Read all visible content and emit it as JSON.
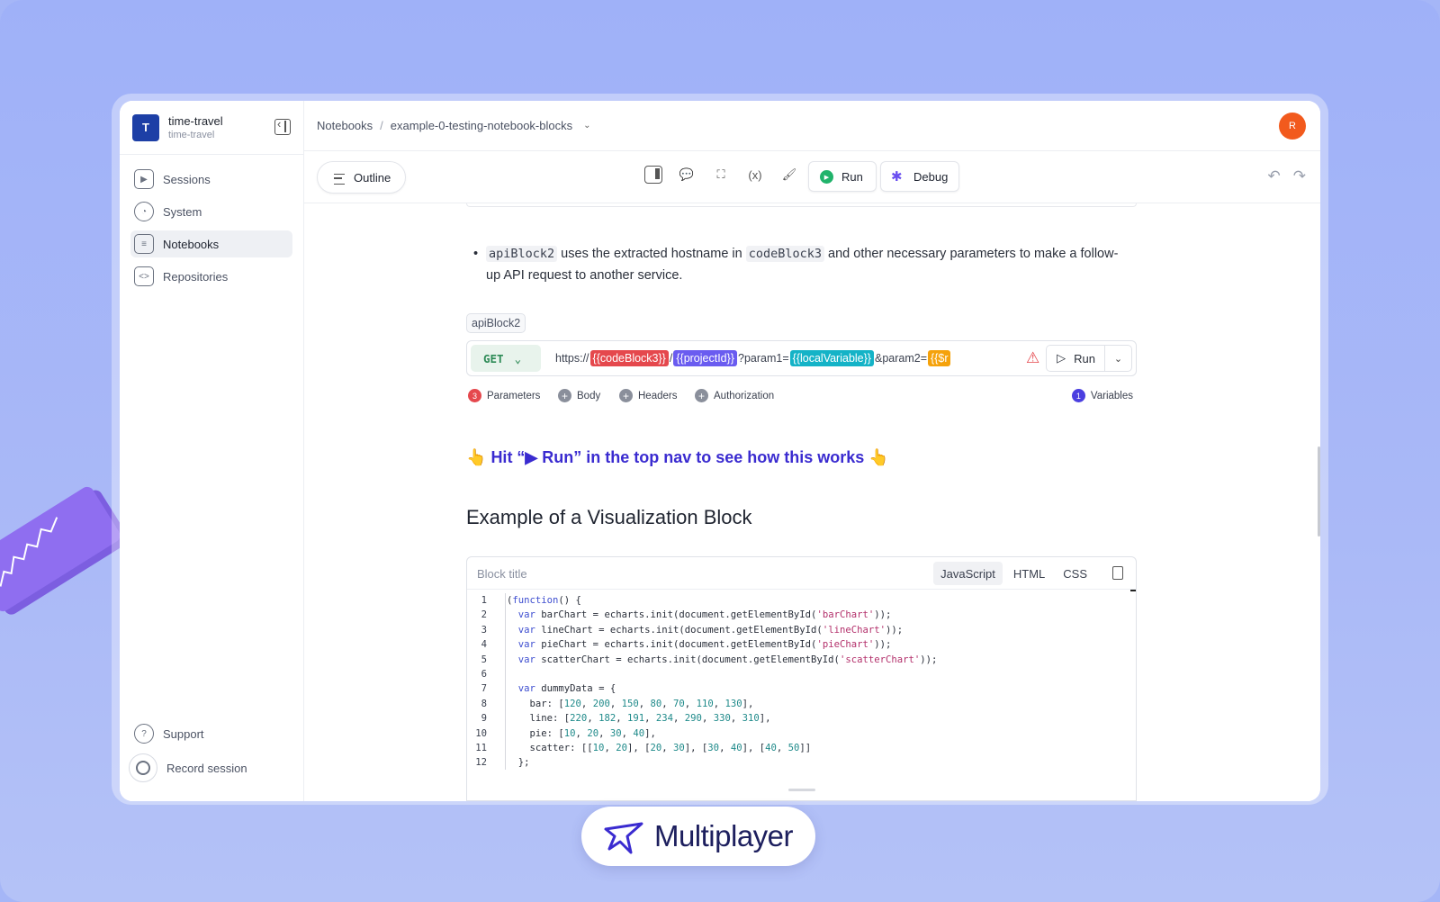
{
  "workspace": {
    "initial": "T",
    "name": "time-travel",
    "sub": "time-travel"
  },
  "nav": {
    "items": [
      {
        "label": "Sessions",
        "icon": "play-icon"
      },
      {
        "label": "System",
        "icon": "system-icon"
      },
      {
        "label": "Notebooks",
        "icon": "notebook-icon",
        "active": true
      },
      {
        "label": "Repositories",
        "icon": "code-icon"
      }
    ],
    "support": "Support",
    "record": "Record session"
  },
  "breadcrumb": {
    "root": "Notebooks",
    "sep": "/",
    "current": "example-0-testing-notebook-blocks"
  },
  "user": {
    "initial": "R",
    "color": "#f25a1d"
  },
  "toolbar": {
    "outline": "Outline",
    "run": "Run",
    "debug": "Debug",
    "var_icon": "(x)"
  },
  "content": {
    "bullet": {
      "code1": "apiBlock2",
      "t1": " uses the extracted hostname in ",
      "code2": "codeBlock3",
      "t2": " and other necessary parameters to make a follow-up API request to another service."
    },
    "api_block": {
      "tag": "apiBlock2",
      "method": "GET",
      "url_prefix": "https://",
      "var1": "{{codeBlock3}}",
      "slash": "/",
      "var2": "{{projectId}}",
      "q1": "?param1=",
      "var3": "{{localVariable}}",
      "q2": "&param2=",
      "var4": "{{$r",
      "run": "Run",
      "tabs": {
        "parameters_count": "3",
        "parameters": "Parameters",
        "body": "Body",
        "headers": "Headers",
        "authorization": "Authorization",
        "variables_count": "1",
        "variables": "Variables"
      }
    },
    "hint": {
      "pre": "👆",
      "text": "Hit “▶ Run” in the top nav to see how this works",
      "post": "👆"
    },
    "heading": "Example of a Visualization Block",
    "code_block": {
      "title_placeholder": "Block title",
      "langs": [
        "JavaScript",
        "HTML",
        "CSS"
      ],
      "active_lang": "JavaScript",
      "lines": [
        "(function() {",
        "  var barChart = echarts.init(document.getElementById('barChart'));",
        "  var lineChart = echarts.init(document.getElementById('lineChart'));",
        "  var pieChart = echarts.init(document.getElementById('pieChart'));",
        "  var scatterChart = echarts.init(document.getElementById('scatterChart'));",
        "",
        "  var dummyData = {",
        "    bar: [120, 200, 150, 80, 70, 110, 130],",
        "    line: [220, 182, 191, 234, 290, 330, 310],",
        "    pie: [10, 20, 30, 40],",
        "    scatter: [[10, 20], [20, 30], [30, 40], [40, 50]]",
        "  };"
      ]
    }
  },
  "brand": {
    "name": "Multiplayer",
    "color": "#3a2bd0"
  }
}
